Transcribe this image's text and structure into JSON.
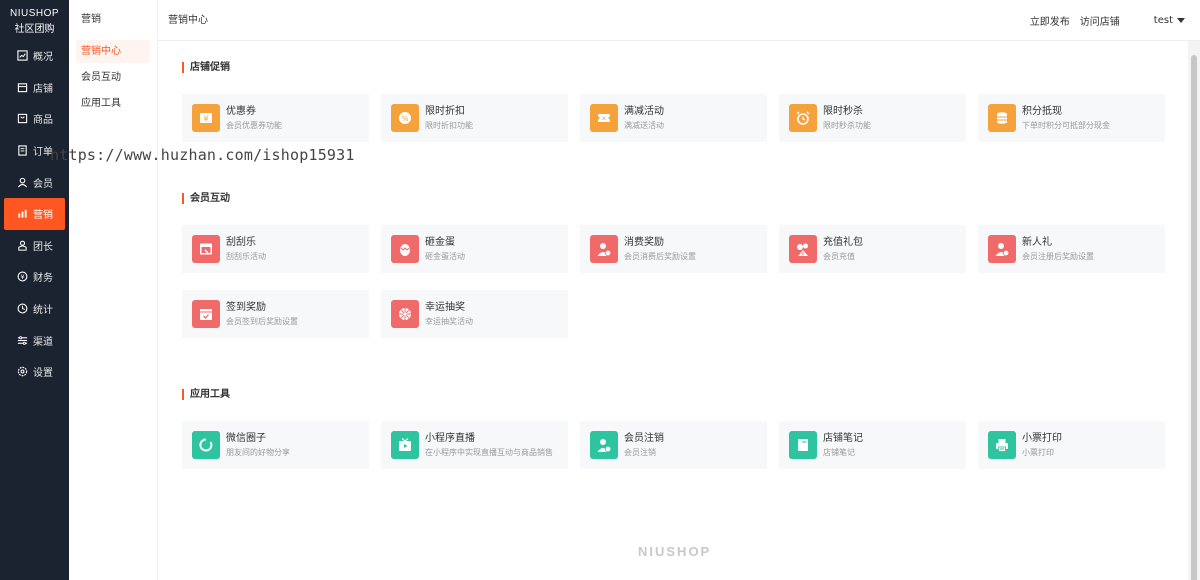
{
  "brand": {
    "line1": "NIUSHOP",
    "line2": "社区团购"
  },
  "nav": [
    {
      "label": "概况",
      "icon": "chart-icon"
    },
    {
      "label": "店铺",
      "icon": "store-icon"
    },
    {
      "label": "商品",
      "icon": "goods-icon"
    },
    {
      "label": "订单",
      "icon": "order-icon"
    },
    {
      "label": "会员",
      "icon": "member-icon"
    },
    {
      "label": "营销",
      "icon": "marketing-icon",
      "active": true
    },
    {
      "label": "团长",
      "icon": "leader-icon"
    },
    {
      "label": "财务",
      "icon": "finance-icon"
    },
    {
      "label": "统计",
      "icon": "stats-icon"
    },
    {
      "label": "渠道",
      "icon": "channel-icon"
    },
    {
      "label": "设置",
      "icon": "settings-icon"
    }
  ],
  "subnav": {
    "title": "营销",
    "items": [
      {
        "label": "营销中心",
        "active": true
      },
      {
        "label": "会员互动"
      },
      {
        "label": "应用工具"
      }
    ]
  },
  "header": {
    "breadcrumb": "营销中心",
    "publish": "立即发布",
    "visit": "访问店铺",
    "user": "test"
  },
  "sections": [
    {
      "title": "店铺促销",
      "cards": [
        {
          "title": "优惠券",
          "desc": "会员优惠券功能",
          "icon": "coupon-icon",
          "color": "#f5a13c"
        },
        {
          "title": "限时折扣",
          "desc": "限时折扣功能",
          "icon": "discount-icon",
          "color": "#f5a13c"
        },
        {
          "title": "满减活动",
          "desc": "满减送活动",
          "icon": "ticket-icon",
          "color": "#f5a13c"
        },
        {
          "title": "限时秒杀",
          "desc": "限时秒杀功能",
          "icon": "alarm-icon",
          "color": "#f5a13c"
        },
        {
          "title": "积分抵现",
          "desc": "下单时积分可抵部分现金",
          "icon": "coins-icon",
          "color": "#f5a13c"
        }
      ]
    },
    {
      "title": "会员互动",
      "cards": [
        {
          "title": "刮刮乐",
          "desc": "刮刮乐活动",
          "icon": "scratch-icon",
          "color": "#f16a6a"
        },
        {
          "title": "砸金蛋",
          "desc": "砸金蛋活动",
          "icon": "egg-icon",
          "color": "#f16a6a"
        },
        {
          "title": "消费奖励",
          "desc": "会员消费后奖励设置",
          "icon": "user-reward-icon",
          "color": "#f16a6a"
        },
        {
          "title": "充值礼包",
          "desc": "会员充值",
          "icon": "gift-pack-icon",
          "color": "#f16a6a"
        },
        {
          "title": "新人礼",
          "desc": "会员注册后奖励设置",
          "icon": "new-user-icon",
          "color": "#f16a6a"
        },
        {
          "title": "签到奖励",
          "desc": "会员签到后奖励设置",
          "icon": "calendar-check-icon",
          "color": "#f16a6a"
        },
        {
          "title": "幸运抽奖",
          "desc": "幸运抽奖活动",
          "icon": "wheel-icon",
          "color": "#f16a6a"
        }
      ]
    },
    {
      "title": "应用工具",
      "cards": [
        {
          "title": "微信圈子",
          "desc": "朋友间的好物分享",
          "icon": "circle-icon",
          "color": "#2ec4a0"
        },
        {
          "title": "小程序直播",
          "desc": "在小程序中实现直播互动与商品销售",
          "icon": "live-tv-icon",
          "color": "#2ec4a0"
        },
        {
          "title": "会员注销",
          "desc": "会员注销",
          "icon": "user-cancel-icon",
          "color": "#2ec4a0"
        },
        {
          "title": "店铺笔记",
          "desc": "店铺笔记",
          "icon": "notebook-icon",
          "color": "#2ec4a0"
        },
        {
          "title": "小票打印",
          "desc": "小票打印",
          "icon": "printer-icon",
          "color": "#2ec4a0"
        }
      ]
    }
  ],
  "watermark": "https://www.huzhan.com/ishop15931",
  "footer_logo": "NIUSHOP"
}
